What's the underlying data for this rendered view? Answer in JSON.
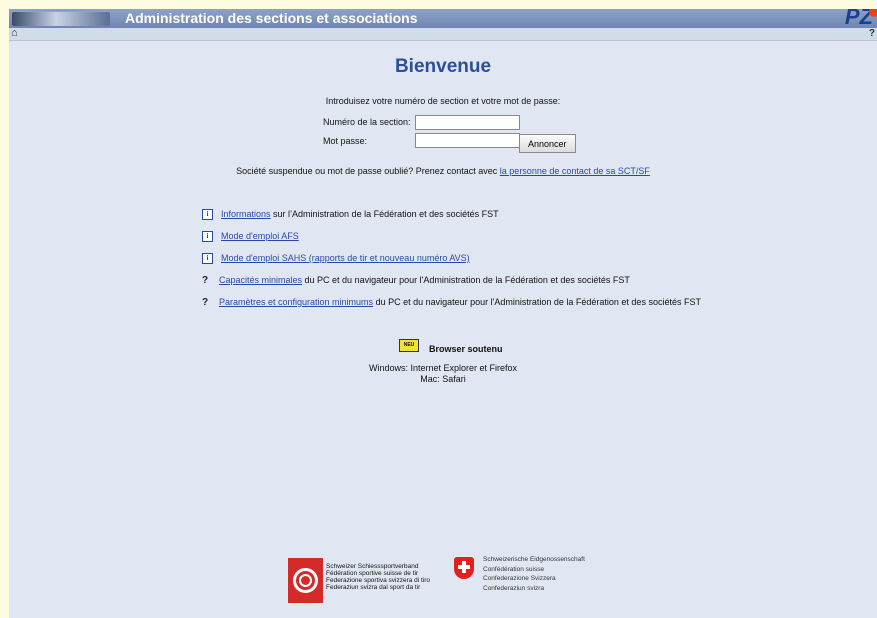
{
  "header": {
    "title": "Administration des sections et associations",
    "brand": "PZ"
  },
  "page_title": "Bienvenue",
  "login": {
    "intro": "Introduisez votre numéro de section et votre mot de passe:",
    "section_label": "Numéro de la section:",
    "section_value": "",
    "password_label": "Mot passe:",
    "password_value": "",
    "submit_label": "Annoncer"
  },
  "forgot": {
    "text": "Société suspendue ou mot de passe oublié? Prenez contact avec",
    "link": "la personne de contact de sa SCT/SF"
  },
  "links": [
    {
      "icon": "info-icon",
      "link": "Informations",
      "text": " sur l’Administration de la Fédération et des sociétés FST"
    },
    {
      "icon": "info-icon",
      "link": "Mode d'emploi AFS",
      "text": ""
    },
    {
      "icon": "info-icon",
      "link": "Mode d'emploi SAHS (rapports de tir et nouveau numéro AVS)",
      "text": ""
    },
    {
      "icon": "help-icon",
      "link": "Capacités minimales",
      "text": " du PC et du navigateur pour l'Administration de la Fédération et des sociétés FST"
    },
    {
      "icon": "help-icon",
      "link": "Paramètres et configuration minimums",
      "text": " du PC et du navigateur pour l'Administration de la Fédération et des sociétés FST"
    }
  ],
  "browser": {
    "badge": "NEU",
    "title": "Browser soutenu",
    "line1": "Windows: Internet Explorer et Firefox",
    "line2": "Mac: Safari"
  },
  "footer": {
    "ssv": [
      "Schweizer Schiesssportverband",
      "Fédération sportive suisse de tir",
      "Federazione sportiva svizzera di tiro",
      "Federaziun svizra dal sport da tir"
    ],
    "confed": [
      "Schweizerische Eidgenossenschaft",
      "Confédération suisse",
      "Confederazione Svizzera",
      "Confederaziun svizra"
    ]
  }
}
